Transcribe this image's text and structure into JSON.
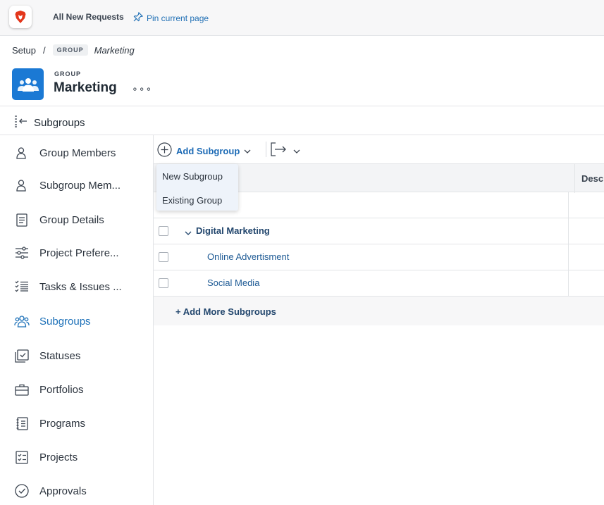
{
  "topbar": {
    "requests_label": "All New Requests",
    "pin_label": "Pin current page"
  },
  "breadcrumb": {
    "root": "Setup",
    "separator": "/",
    "tag": "GROUP",
    "current": "Marketing"
  },
  "header": {
    "type_label": "GROUP",
    "title": "Marketing",
    "more": "∘∘∘"
  },
  "subheader": {
    "title": "Subgroups"
  },
  "sidebar": {
    "items": [
      {
        "label": "Group Members",
        "icon": "person-icon"
      },
      {
        "label": "Subgroup Mem...",
        "icon": "person-icon"
      },
      {
        "label": "Group Details",
        "icon": "document-icon"
      },
      {
        "label": "Project Prefere...",
        "icon": "sliders-icon"
      },
      {
        "label": "Tasks & Issues ...",
        "icon": "checklist-icon"
      },
      {
        "label": "Subgroups",
        "icon": "people-icon",
        "active": true
      },
      {
        "label": "Statuses",
        "icon": "status-icon"
      },
      {
        "label": "Portfolios",
        "icon": "briefcase-icon"
      },
      {
        "label": "Programs",
        "icon": "program-icon"
      },
      {
        "label": "Projects",
        "icon": "project-icon"
      },
      {
        "label": "Approvals",
        "icon": "check-circle-icon"
      }
    ]
  },
  "toolbar": {
    "add_label": "Add Subgroup"
  },
  "dropdown": {
    "items": [
      "New Subgroup",
      "Existing Group"
    ]
  },
  "table": {
    "columns": [
      "Descri"
    ],
    "rows": [
      {
        "name": "Digital Marketing",
        "level": 0,
        "expanded": true
      },
      {
        "name": "Online Advertisment",
        "level": 1
      },
      {
        "name": "Social Media",
        "level": 1
      }
    ],
    "add_more": "+ Add More Subgroups"
  },
  "colors": {
    "accent": "#1c70b8",
    "group_icon_bg": "#1b79d4",
    "brand_logo": "#e3361b"
  }
}
